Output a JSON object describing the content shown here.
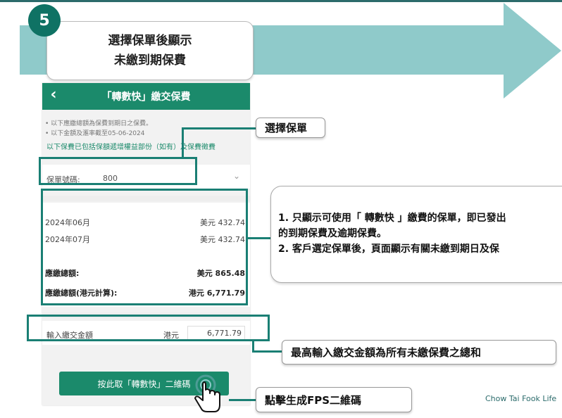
{
  "step": {
    "number": "5",
    "title_line1": "選擇保單後顯示",
    "title_line2": "未繳到期保費"
  },
  "phone": {
    "header_title": "「轉數快」繳交保費",
    "back_icon": "chevron-left-icon",
    "notes": [
      "• 以下應繳總額為保費到期日之保費。",
      "• 以下金額及滙率截至05-06-2024"
    ],
    "note_link": "以下保費已包括保額遞增權益部份（如有）及保費徵費",
    "policy_label": "保單號碼:",
    "policy_value": "800",
    "premiums": [
      {
        "month": "2024年06月",
        "amount": "美元 432.74"
      },
      {
        "month": "2024年07月",
        "amount": "美元 432.74"
      }
    ],
    "total_label": "應繳總額:",
    "total_amount": "美元 865.48",
    "total_hkd_label": "應繳總額(港元計算):",
    "total_hkd_amount": "港元 6,771.79",
    "input_label": "輸入繳交金額",
    "input_currency": "港元",
    "input_value": "6,771.79",
    "qr_button_label": "按此取「轉數快」二維碼"
  },
  "callouts": {
    "select_policy": "選擇保單",
    "info_line1": "1. 只顯示可使用「 轉數快 」繳費的保單，即已發出",
    "info_line2": "的到期保費及逾期保費。",
    "info_line3": "2. 客戶選定保單後，頁面顯示有關未繳到期日及保",
    "max_amount": "最高輸入繳交金額為所有未繳保費之總和",
    "click_qr": "點擊生成FPS二維碼"
  },
  "brand": "Chow Tai Fook Life",
  "colors": {
    "teal_dark": "#0f7264",
    "teal_band": "#8fcaca",
    "header_green": "#1b8a6b",
    "highlight": "#1a7f74"
  }
}
